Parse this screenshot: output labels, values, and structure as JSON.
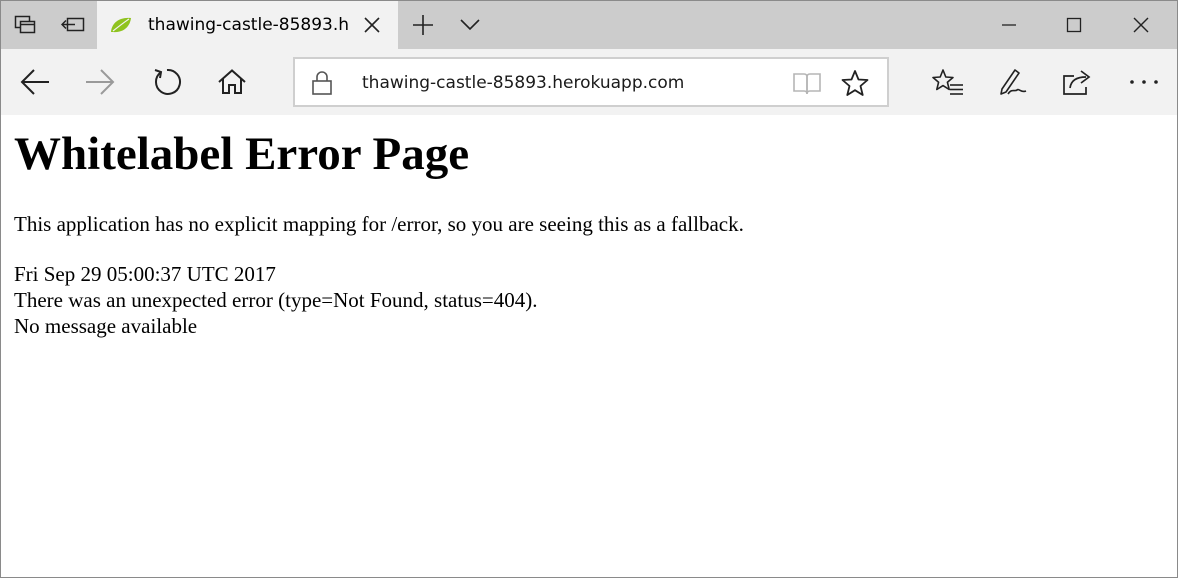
{
  "browser": {
    "tab": {
      "title": "thawing-castle-85893.h"
    },
    "address_bar": {
      "url": "thawing-castle-85893.herokuapp.com"
    },
    "icons": {
      "tab_actions": "tab-actions-icon",
      "set_aside": "set-aside-tabs-icon",
      "favicon": "spring-leaf-favicon",
      "tab_close": "close-icon",
      "new_tab": "plus-icon",
      "tab_list": "chevron-down-icon",
      "minimize": "minimize-icon",
      "maximize": "maximize-icon",
      "close_window": "close-icon",
      "back": "back-arrow-icon",
      "forward": "forward-arrow-icon",
      "refresh": "refresh-icon",
      "home": "home-icon",
      "lock": "lock-icon",
      "reading_view": "reading-view-icon",
      "favorite": "star-icon",
      "favorites_hub": "favorites-hub-icon",
      "web_note": "pen-note-icon",
      "share": "share-icon",
      "more": "more-dots-icon"
    },
    "colors": {
      "tab_strip": "#cccccc",
      "active_tab": "#f2f2f2",
      "nav_bar": "#f2f2f2",
      "favicon_green": "#8fc31f"
    }
  },
  "page": {
    "heading": "Whitelabel Error Page",
    "message": "This application has no explicit mapping for /error, so you are seeing this as a fallback.",
    "timestamp": "Fri Sep 29 05:00:37 UTC 2017",
    "error_line": "There was an unexpected error (type=Not Found, status=404).",
    "detail": "No message available"
  }
}
